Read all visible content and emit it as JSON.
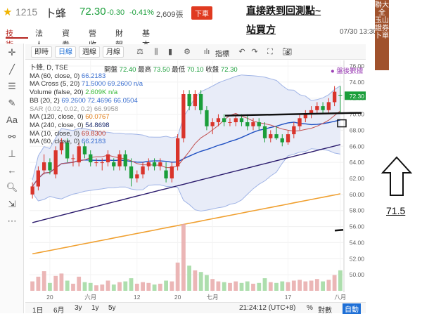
{
  "header": {
    "code": "1215",
    "name": "卜蜂",
    "price": "72.30",
    "change": "-0.30",
    "change_pct": "-0.41%",
    "volume": "2,609張",
    "flag": "下車"
  },
  "annotations": {
    "line1": "直接跌到回測點~",
    "line2": "站買方",
    "target_value": "71.5"
  },
  "nav": {
    "tabs": [
      "技術",
      "法人",
      "資券",
      "營收",
      "財報",
      "基本"
    ],
    "active_index": 0,
    "timestamp": "07/30 13:30"
  },
  "banner": {
    "text": "聯大全 玉山證券卜單",
    "color": "#a0522d"
  },
  "left_toolbar": [
    {
      "name": "crosshair-icon",
      "glyph": "✛"
    },
    {
      "name": "line-tool-icon",
      "glyph": "╱"
    },
    {
      "name": "horizontal-lines-icon",
      "glyph": "☰"
    },
    {
      "name": "brush-icon",
      "glyph": "✎"
    },
    {
      "name": "text-tool-icon",
      "glyph": "Aa"
    },
    {
      "name": "pattern-icon",
      "glyph": "⚯"
    },
    {
      "name": "fib-icon",
      "glyph": "⊥"
    },
    {
      "name": "back-arrow-icon",
      "glyph": "←"
    },
    {
      "name": "zoom-icon",
      "glyph": "🔍︎"
    },
    {
      "name": "measure-icon",
      "glyph": "⇲"
    },
    {
      "name": "more-icon",
      "glyph": "⋯"
    }
  ],
  "chart_toolbar": {
    "periods": [
      "即時",
      "日線",
      "週線",
      "月線"
    ],
    "selected_index": 1,
    "indicator_label": "指標"
  },
  "legend": {
    "symbol": "卜蜂, D, TSE",
    "open_label": "開盤",
    "open": "72.40",
    "high_label": "最高",
    "high": "73.50",
    "low_label": "最低",
    "low": "70.10",
    "close_label": "收盤",
    "close": "72.30",
    "after_hours": "盤後數據",
    "rows": [
      {
        "label": "MA (60, close, 0)",
        "value": "66.2183",
        "cls": "blue"
      },
      {
        "label": "MA Cross (5, 20)",
        "value": "71.5000 69.2600 n/a",
        "cls": "blue"
      },
      {
        "label": "Volume (false, 20)",
        "value": "2.609K n/a",
        "cls": "green"
      },
      {
        "label": "BB (20, 2)",
        "value": "69.2600 72.4696 66.0504",
        "cls": "blue"
      },
      {
        "label": "SAR (0.02, 0.02, 0.2)",
        "value": "66.9958",
        "cls": "gray"
      },
      {
        "label": "MA (120, close, 0)",
        "value": "60.0767",
        "cls": "orange"
      },
      {
        "label": "MA (240, close, 0)",
        "value": "54.8698",
        "cls": "dkblue"
      },
      {
        "label": "MA (10, close, 0)",
        "value": "69.8300",
        "cls": "pink"
      },
      {
        "label": "MA (60, close, 0)",
        "value": "66.2183",
        "cls": "blue"
      }
    ]
  },
  "bottom_bar": {
    "ranges": [
      "1日",
      "6月",
      "3y",
      "1y",
      "5y"
    ],
    "clock": "21:24:12 (UTC+8)",
    "percent": "%",
    "log": "對數",
    "auto": "自動"
  },
  "colors": {
    "up": "#d9342b",
    "down": "#1a9e3a",
    "ma60": "#1e4fc2",
    "ma10": "#c25050",
    "ma120": "#f0a030",
    "ma240": "#2a1a6c",
    "bb": "#a0b4e6"
  },
  "chart_data": {
    "type": "candlestick",
    "title": "",
    "xlabel": "",
    "ylabel": "",
    "ylim": [
      48,
      76
    ],
    "y_ticks": [
      50,
      52,
      54,
      56,
      58,
      60,
      62,
      64,
      66,
      68,
      70,
      72,
      74,
      76
    ],
    "x_ticks": [
      {
        "label": "20",
        "index": 3
      },
      {
        "label": "六月",
        "index": 10
      },
      {
        "label": "12",
        "index": 18
      },
      {
        "label": "20",
        "index": 25
      },
      {
        "label": "七月",
        "index": 31
      },
      {
        "label": "17",
        "index": 44
      },
      {
        "label": "八月",
        "index": 53
      }
    ],
    "candles": [
      [
        60.0,
        61.5,
        59.5,
        61.0
      ],
      [
        61.0,
        63.5,
        60.5,
        63.0
      ],
      [
        63.0,
        65.0,
        62.5,
        64.0
      ],
      [
        64.0,
        64.5,
        62.5,
        63.0
      ],
      [
        62.5,
        66.0,
        62.0,
        65.5
      ],
      [
        65.5,
        67.0,
        65.0,
        66.5
      ],
      [
        66.5,
        67.0,
        64.0,
        64.5
      ],
      [
        64.5,
        65.0,
        63.5,
        64.5
      ],
      [
        64.0,
        66.5,
        63.5,
        66.0
      ],
      [
        66.0,
        66.5,
        64.5,
        65.0
      ],
      [
        65.0,
        65.5,
        63.5,
        64.0
      ],
      [
        64.0,
        64.5,
        63.5,
        64.0
      ],
      [
        64.0,
        64.5,
        63.0,
        64.0
      ],
      [
        64.0,
        65.5,
        63.5,
        65.0
      ],
      [
        64.0,
        64.5,
        63.0,
        63.5
      ],
      [
        63.5,
        65.5,
        63.0,
        65.0
      ],
      [
        65.0,
        65.5,
        63.0,
        63.5
      ],
      [
        63.5,
        64.5,
        61.0,
        62.0
      ],
      [
        62.0,
        63.0,
        61.5,
        62.5
      ],
      [
        62.5,
        64.0,
        62.0,
        63.5
      ],
      [
        63.5,
        64.5,
        63.0,
        64.0
      ],
      [
        64.0,
        64.5,
        63.0,
        63.5
      ],
      [
        63.5,
        64.5,
        63.0,
        64.0
      ],
      [
        63.0,
        64.0,
        61.5,
        62.0
      ],
      [
        62.0,
        64.0,
        61.5,
        63.5
      ],
      [
        63.5,
        67.5,
        63.0,
        67.0
      ],
      [
        67.0,
        73.0,
        66.5,
        72.5
      ],
      [
        72.5,
        73.0,
        70.5,
        71.0
      ],
      [
        71.0,
        73.0,
        70.5,
        72.5
      ],
      [
        72.5,
        73.0,
        70.0,
        70.5
      ],
      [
        70.5,
        71.0,
        68.0,
        68.5
      ],
      [
        68.5,
        69.5,
        67.5,
        69.0
      ],
      [
        69.0,
        70.0,
        68.5,
        69.5
      ],
      [
        69.5,
        70.0,
        68.5,
        69.0
      ],
      [
        69.0,
        69.5,
        68.5,
        69.0
      ],
      [
        69.0,
        70.0,
        68.5,
        69.5
      ],
      [
        69.5,
        70.0,
        68.5,
        69.0
      ],
      [
        69.0,
        70.0,
        68.0,
        68.5
      ],
      [
        68.5,
        69.5,
        68.0,
        69.0
      ],
      [
        69.0,
        69.5,
        68.0,
        68.5
      ],
      [
        68.5,
        69.0,
        66.5,
        67.0
      ],
      [
        67.0,
        68.0,
        66.5,
        67.5
      ],
      [
        67.5,
        68.5,
        66.8,
        67.0
      ],
      [
        67.0,
        67.5,
        66.0,
        66.5
      ],
      [
        66.5,
        68.0,
        66.2,
        67.5
      ],
      [
        67.5,
        69.0,
        67.0,
        68.5
      ],
      [
        68.5,
        70.0,
        68.0,
        69.5
      ],
      [
        69.5,
        70.5,
        69.0,
        70.0
      ],
      [
        70.0,
        71.0,
        69.5,
        70.5
      ],
      [
        70.5,
        71.5,
        70.0,
        71.0
      ],
      [
        71.0,
        71.5,
        70.0,
        70.5
      ],
      [
        70.5,
        72.0,
        70.0,
        71.5
      ],
      [
        71.5,
        73.5,
        71.0,
        72.8
      ],
      [
        72.4,
        73.5,
        70.1,
        72.3
      ]
    ],
    "volume": [
      1.2,
      1.8,
      2.5,
      1.0,
      1.9,
      2.2,
      1.3,
      0.9,
      1.8,
      1.1,
      1.0,
      0.7,
      0.8,
      1.3,
      0.8,
      1.1,
      1.2,
      1.6,
      0.9,
      1.1,
      1.0,
      0.8,
      0.9,
      1.3,
      1.2,
      3.6,
      8.5,
      3.2,
      2.6,
      2.4,
      2.0,
      1.5,
      1.2,
      1.1,
      1.0,
      1.2,
      1.0,
      1.2,
      0.9,
      1.0,
      1.6,
      1.1,
      1.0,
      1.2,
      1.1,
      1.3,
      1.4,
      1.2,
      1.3,
      1.5,
      1.2,
      1.4,
      2.0,
      2.6
    ]
  }
}
